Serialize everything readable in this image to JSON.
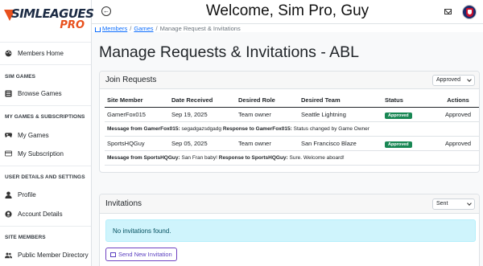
{
  "logo": {
    "top": "SIMLEAGUES",
    "bottom": "PRO"
  },
  "header": {
    "welcome": "Welcome, Sim Pro, Guy"
  },
  "sidebar": {
    "home": "Members Home",
    "sim_games_heading": "SIM GAMES",
    "browse_games": "Browse Games",
    "my_games_heading": "MY GAMES & SUBSCRIPTIONS",
    "my_games": "My Games",
    "my_subscription": "My Subscription",
    "user_heading": "USER DETAILS AND SETTINGS",
    "profile": "Profile",
    "account_details": "Account Details",
    "site_members_heading": "SITE MEMBERS",
    "public_directory": "Public Member Directory"
  },
  "breadcrumb": {
    "members": "Members",
    "games": "Games",
    "current": "Manage Request & Invitations"
  },
  "page": {
    "title": "Manage Requests & Invitations - ABL"
  },
  "join_requests": {
    "title": "Join Requests",
    "filter_value": "Approved",
    "columns": [
      "Site Member",
      "Date Received",
      "Desired Role",
      "Desired Team",
      "Status",
      "Actions"
    ],
    "rows": [
      {
        "member": "GamerFox015",
        "date": "Sep 19, 2025",
        "role": "Team owner",
        "team": "Seattle Lightning",
        "status": "Approved",
        "action": "Approved",
        "msg_label": "Message from GamerFox015:",
        "msg": "segadgazsdgadg",
        "resp_label": "Response to GamerFox015:",
        "resp": "Status changed by Game Owner"
      },
      {
        "member": "SportsHQGuy",
        "date": "Sep 05, 2025",
        "role": "Team owner",
        "team": "San Francisco Blaze",
        "status": "Approved",
        "action": "Approved",
        "msg_label": "Message from SportsHQGuy:",
        "msg": "San Fran baby!",
        "resp_label": "Response to SportsHQGuy:",
        "resp": "Sure. Welcome aboard!"
      }
    ]
  },
  "invitations": {
    "title": "Invitations",
    "filter_value": "Sent",
    "empty_message": "No invitations found.",
    "send_button": "Send New Invitation"
  },
  "colors": {
    "accent": "#e8501d",
    "brand_dark": "#1c2b44",
    "success": "#198754",
    "info_bg": "#cff4fc",
    "link": "#0d6efd"
  }
}
